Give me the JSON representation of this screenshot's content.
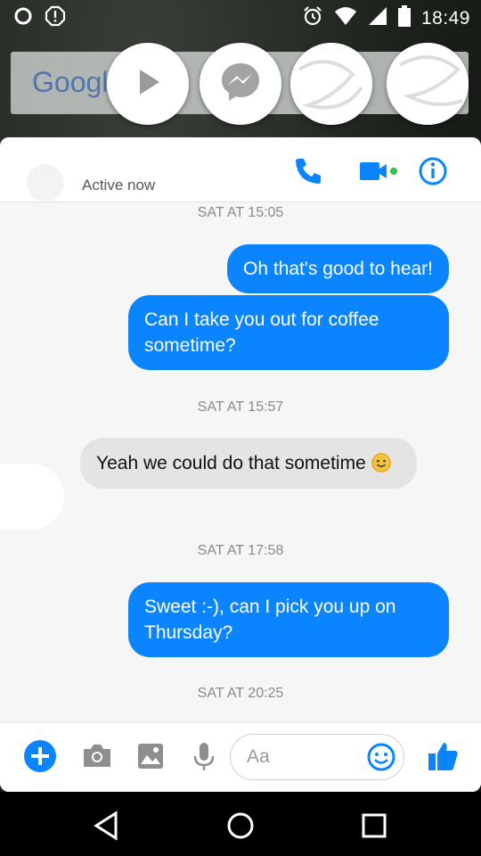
{
  "status_bar": {
    "time": "18:49"
  },
  "background": {
    "google_text": "Googl"
  },
  "chat": {
    "status": "Active now",
    "messages": [
      {
        "type": "timestamp",
        "text": "SAT AT 15:05"
      },
      {
        "type": "outgoing",
        "text": "Oh that's good to hear!"
      },
      {
        "type": "outgoing",
        "text": "Can I take you out for coffee sometime?"
      },
      {
        "type": "timestamp",
        "text": "SAT AT 15:57"
      },
      {
        "type": "incoming",
        "text": "Yeah we could do that sometime"
      },
      {
        "type": "timestamp",
        "text": "SAT AT 17:58"
      },
      {
        "type": "outgoing",
        "text": "Sweet :-), can I pick you up on Thursday?"
      },
      {
        "type": "timestamp",
        "text": "SAT AT 20:25"
      }
    ]
  },
  "composer": {
    "placeholder": "Aa"
  },
  "colors": {
    "accent": "#0a84ff",
    "incoming_bubble": "#e4e4e4",
    "online_dot": "#31c24d"
  },
  "icons": [
    "sync-icon",
    "alert-icon",
    "alarm-icon",
    "wifi-icon",
    "signal-icon",
    "battery-icon",
    "play-icon",
    "messenger-icon",
    "phone-icon",
    "video-icon",
    "info-icon",
    "plus-icon",
    "camera-icon",
    "image-icon",
    "mic-icon",
    "emoji-icon",
    "thumbs-up-icon",
    "back-icon",
    "home-icon",
    "recents-icon"
  ]
}
